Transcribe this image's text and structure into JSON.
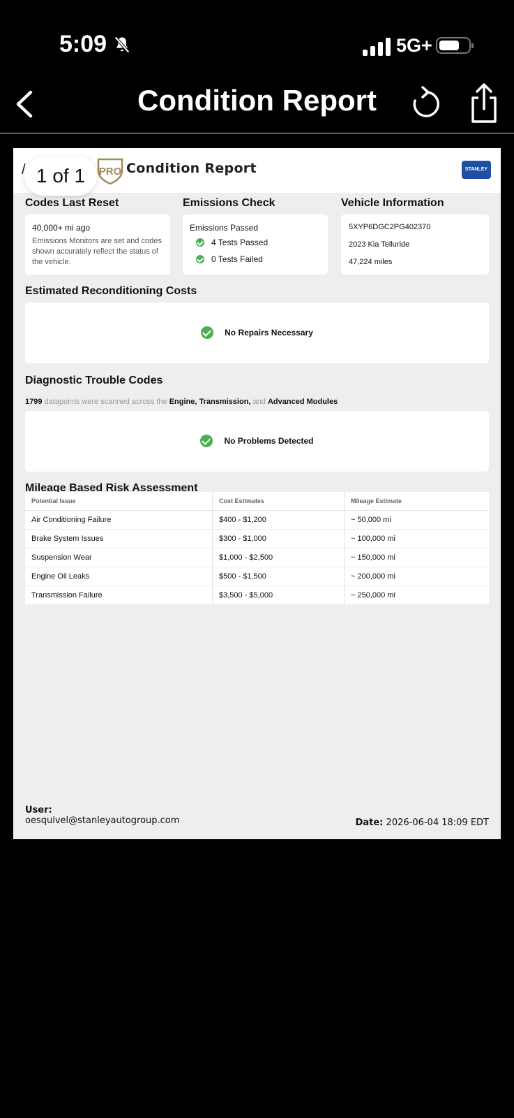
{
  "status": {
    "time": "5:09",
    "network": "5G+"
  },
  "nav": {
    "title": "Condition Report"
  },
  "pager": {
    "label": "1 of 1"
  },
  "doc": {
    "header_title": "Condition Report",
    "dealer_logo_text": "STANLEY",
    "codes_reset": {
      "title": "Codes Last Reset",
      "value": "40,000+ mi ago",
      "note": "Emissions Monitors are set and codes shown accurately reflect the status of the vehicle."
    },
    "emissions": {
      "title": "Emissions Check",
      "status": "Emissions Passed",
      "passed": "4 Tests Passed",
      "failed": "0 Tests Failed"
    },
    "vehicle": {
      "title": "Vehicle Information",
      "vin": "5XYP6DGC2PG402370",
      "model": "2023 Kia Telluride",
      "miles": "47,224 miles"
    },
    "recon": {
      "title": "Estimated Reconditioning Costs",
      "status": "No Repairs Necessary"
    },
    "dtc": {
      "title": "Diagnostic Trouble Codes",
      "count": "1799",
      "text1": "datapoints were scanned across the",
      "mod1": "Engine, Transmission,",
      "text2": "and",
      "mod2": "Advanced Modules",
      "status": "No Problems Detected"
    },
    "risk": {
      "title": "Mileage Based Risk Assessment",
      "headers": [
        "Potential Issue",
        "Cost Estimates",
        "Mileage Estimate"
      ],
      "rows": [
        [
          "Air Conditioning Failure",
          "$400 - $1,200",
          "~ 50,000 mi"
        ],
        [
          "Brake System Issues",
          "$300 - $1,000",
          "~ 100,000 mi"
        ],
        [
          "Suspension Wear",
          "$1,000 - $2,500",
          "~ 150,000 mi"
        ],
        [
          "Engine Oil Leaks",
          "$500 - $1,500",
          "~ 200,000 mi"
        ],
        [
          "Transmission Failure",
          "$3,500 - $5,000",
          "~ 250,000 mi"
        ]
      ]
    },
    "footer": {
      "user_label": "User:",
      "user_email": "oesquivel@stanleyautogroup.com",
      "date_label": "Date:",
      "date_value": "2026-06-04 18:09 EDT"
    }
  }
}
